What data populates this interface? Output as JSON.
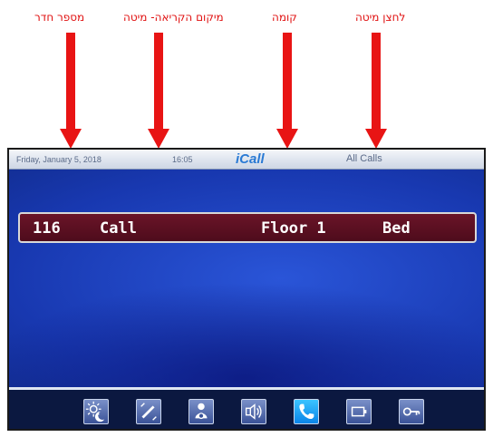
{
  "annotations": [
    {
      "label": "מספר חדר",
      "target": "room-number"
    },
    {
      "label": "מיקום הקריאה- מיטה",
      "target": "call-location"
    },
    {
      "label": "קומה",
      "target": "floor"
    },
    {
      "label": "לחצן מיטה",
      "target": "bed-button"
    }
  ],
  "status_bar": {
    "date": "Friday, January 5, 2018",
    "time": "16:05",
    "logo": "iCall",
    "filter": "All Calls"
  },
  "call": {
    "room": "116",
    "type": "Call",
    "floor": "Floor 1",
    "bed": "Bed"
  },
  "toolbar": {
    "buttons": [
      {
        "icon": "day-night-icon"
      },
      {
        "icon": "edit-icon"
      },
      {
        "icon": "user-settings-icon"
      },
      {
        "icon": "speaker-icon"
      },
      {
        "icon": "phone-icon",
        "active": true
      },
      {
        "icon": "display-icon"
      },
      {
        "icon": "key-icon"
      }
    ]
  },
  "colors": {
    "annotation": "#e01010",
    "call_row": "#5a1020",
    "screen_blue": "#1f44c4",
    "active_button": "#1ea2f4"
  }
}
